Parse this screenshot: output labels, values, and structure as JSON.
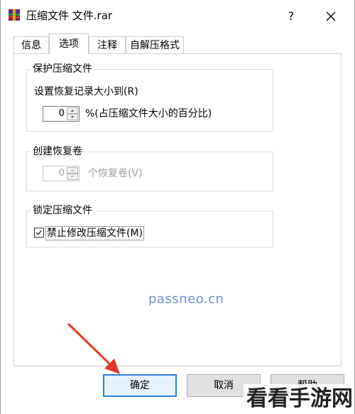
{
  "window": {
    "title": "压缩文件 文件.rar",
    "help_label": "?"
  },
  "tabs": [
    {
      "label": "信息",
      "active": false
    },
    {
      "label": "选项",
      "active": true
    },
    {
      "label": "注释",
      "active": false
    },
    {
      "label": "自解压格式",
      "active": false
    }
  ],
  "protect_group": {
    "title": "保护压缩文件",
    "recovery_label": "设置恢复记录大小到(R)",
    "recovery_value": "0",
    "recovery_unit": "%(占压缩文件大小的百分比)"
  },
  "volume_group": {
    "title": "创建恢复卷",
    "volume_value": "0",
    "volume_unit": "个恢复卷(V)"
  },
  "lock_group": {
    "title": "锁定压缩文件",
    "forbid_label": "禁止修改压缩文件(M)",
    "forbid_checked": true
  },
  "watermark": "passneo.cn",
  "buttons": {
    "ok": "确定",
    "cancel": "取消",
    "help": "帮助"
  },
  "overlay_logo": "看看手游网",
  "colors": {
    "accent": "#2c7fd6",
    "arrow": "#e03b2a",
    "watermark": "#6f8fd6"
  }
}
